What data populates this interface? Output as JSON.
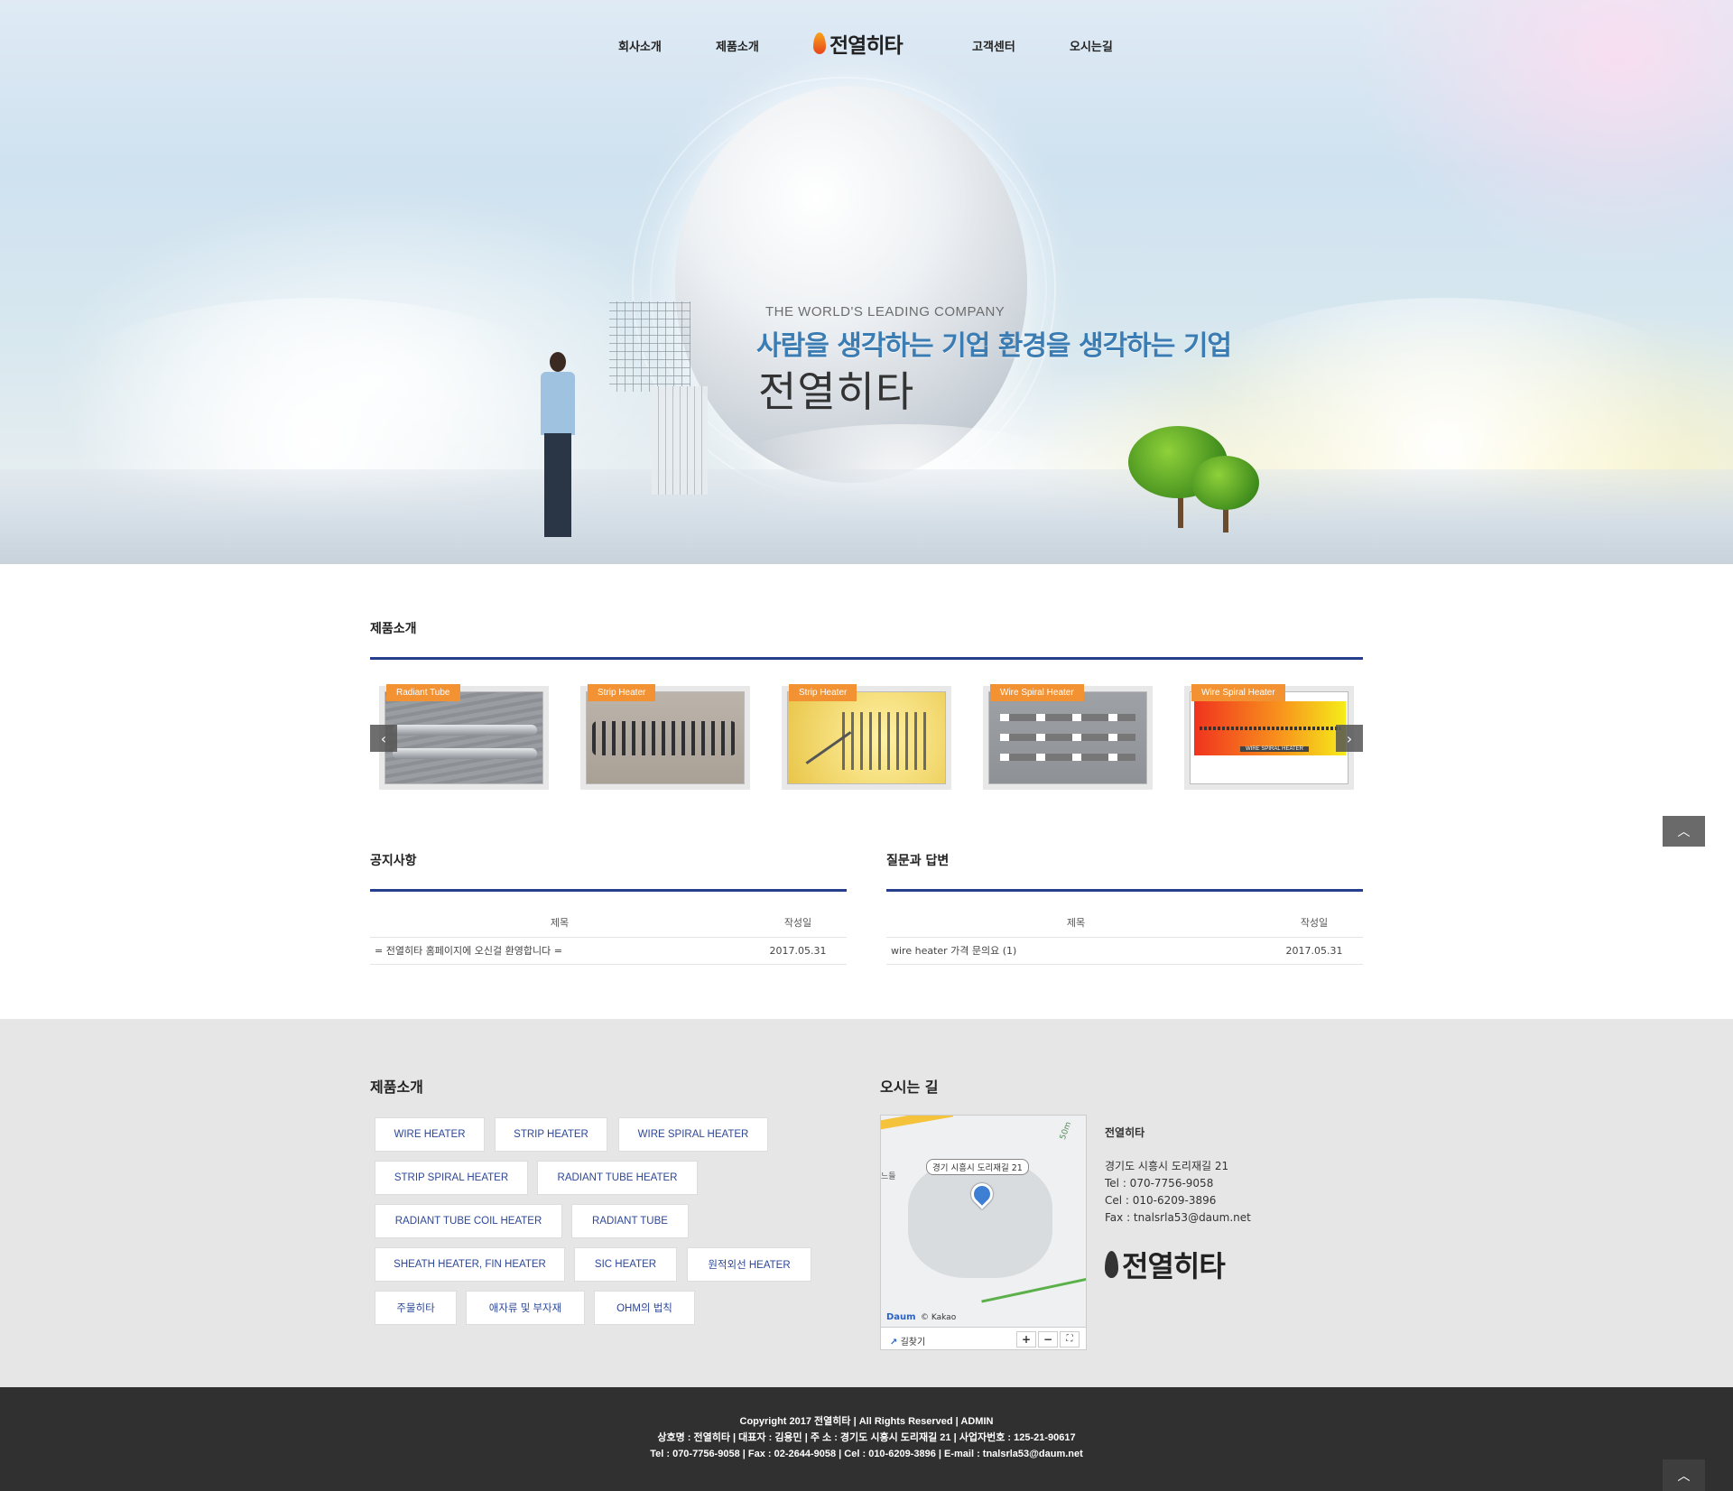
{
  "nav": {
    "items": [
      "회사소개",
      "제품소개",
      "고객센터",
      "오시는길"
    ],
    "logo_text": "전열히타"
  },
  "hero": {
    "subtitle": "THE WORLD'S LEADING COMPANY",
    "headline": "사람을 생각하는 기업 환경을 생각하는 기업",
    "brand": "전열히타"
  },
  "products": {
    "title": "제품소개",
    "cards": [
      {
        "tag": "Radiant Tube",
        "image": "radiant-tube-image"
      },
      {
        "tag": "Strip Heater",
        "image": "strip-heater-image"
      },
      {
        "tag": "Strip Heater",
        "image": "strip-heater-yellow-image"
      },
      {
        "tag": "Wire Spiral Heater",
        "image": "wire-spiral-heater-image"
      },
      {
        "tag": "Wire Spiral Heater",
        "image": "wire-spiral-heater-diagram-image"
      }
    ],
    "diagram_label": "WIRE SPIRAL HEATER"
  },
  "notice": {
    "title": "공지사항",
    "col_title": "제목",
    "col_date": "작성일",
    "rows": [
      {
        "title": "= 전열히타 홈페이지에 오신걸 환영합니다 =",
        "date": "2017.05.31"
      }
    ]
  },
  "qna": {
    "title": "질문과 답변",
    "col_title": "제목",
    "col_date": "작성일",
    "rows": [
      {
        "title": "wire heater 가격 문의요 (1)",
        "date": "2017.05.31"
      }
    ]
  },
  "footer_products": {
    "title": "제품소개",
    "buttons": [
      "WIRE HEATER",
      "STRIP HEATER",
      "WIRE SPIRAL HEATER",
      "STRIP SPIRAL HEATER",
      "RADIANT TUBE HEATER",
      "RADIANT TUBE COIL HEATER",
      "RADIANT TUBE",
      "SHEATH HEATER, FIN HEATER",
      "SIC HEATER",
      "원적외선 HEATER",
      "주물히타",
      "애자류 및 부자재",
      "OHM의 법칙"
    ]
  },
  "location": {
    "title": "오시는 길",
    "map_label": "경기 시흥시 도리재길 21",
    "map_scale": "50m",
    "map_left_label": "느들",
    "map_brand": "Daum",
    "map_copyright": "© Kakao",
    "map_route": "길찾기",
    "zoom_in": "+",
    "zoom_out": "−",
    "fullscreen": "⛶",
    "company": "전열히타",
    "address": "경기도 시흥시 도리재길 21",
    "tel": "Tel : 070-7756-9058",
    "cel": "Cel : 010-6209-3896",
    "fax": "Fax : tnalsrla53@daum.net",
    "logo_text": "전열히타"
  },
  "footer": {
    "line1": "Copyright 2017 전열히타 | All Rights Reserved | ADMIN",
    "line2": "상호명 : 전열히타 | 대표자 : 김용민 | 주 소 : 경기도 시흥시 도리재길 21 | 사업자번호 : 125-21-90617",
    "line3": "Tel : 070-7756-9058 | Fax : 02-2644-9058 | Cel : 010-6209-3896 | E-mail : tnalsrla53@daum.net"
  },
  "icons": {
    "prev": "‹",
    "next": "›",
    "scroll_top": "︿"
  },
  "colors": {
    "accent_rule": "#253f8c",
    "tag_orange": "#f39233",
    "button_text": "#2d4796"
  }
}
